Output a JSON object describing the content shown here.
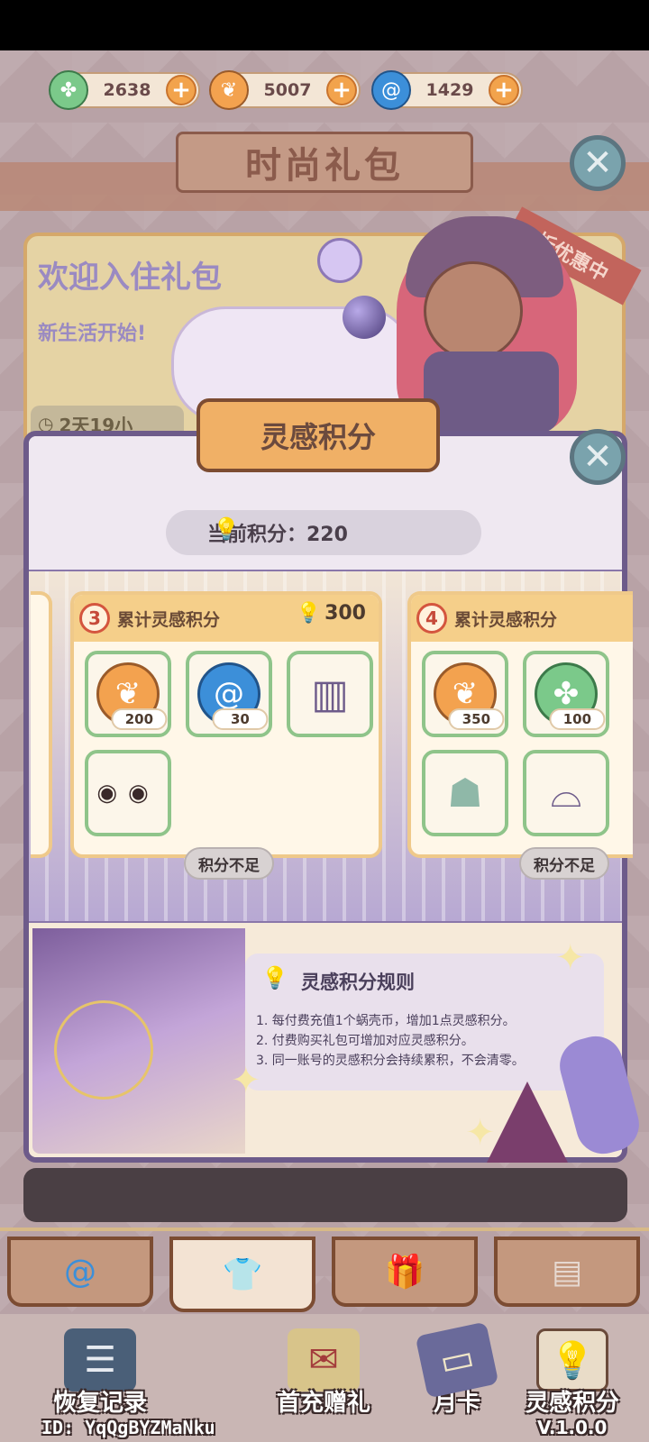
{
  "currencies": [
    {
      "name": "clover-coin",
      "value": "2638",
      "color": "#7bc98a"
    },
    {
      "name": "shell-coin",
      "value": "5007",
      "color": "#f3a24f"
    },
    {
      "name": "swirl-gem",
      "value": "1429",
      "color": "#3c8fd9"
    }
  ],
  "shop_title": "时尚礼包",
  "welcome": {
    "title": "欢迎入住礼包",
    "subtitle": "新生活开始!",
    "timer": "2天19小",
    "discount_badge": "折优惠中"
  },
  "modal": {
    "title": "灵感积分",
    "current_points_label": "当前积分：220",
    "tiers": [
      {
        "number": "3",
        "label": "累计灵感积分",
        "required": "300",
        "items": [
          {
            "icon": "shell-coin-icon",
            "qty": "200"
          },
          {
            "icon": "swirl-gem-icon",
            "qty": "30"
          },
          {
            "icon": "pants-icon",
            "qty": ""
          },
          {
            "icon": "eyes-icon",
            "qty": ""
          }
        ],
        "status": "积分不足"
      },
      {
        "number": "4",
        "label": "累计灵感积分",
        "items": [
          {
            "icon": "shell-coin-icon",
            "qty": "350"
          },
          {
            "icon": "clover-coin-icon",
            "qty": "100"
          },
          {
            "icon": "veil-dress-icon",
            "qty": ""
          },
          {
            "icon": "top-outfit-icon",
            "qty": ""
          }
        ],
        "status": "积分不足"
      }
    ],
    "rules": {
      "title": "灵感积分规则",
      "items": [
        "1. 每付费充值1个蜗壳币，增加1点灵感积分。",
        "2. 付费购买礼包可增加对应灵感积分。",
        "3. 同一账号的灵感积分会持续累积，不会清零。"
      ]
    }
  },
  "tabs": [
    {
      "icon": "swirl-icon",
      "active": false
    },
    {
      "icon": "shirt-icon",
      "active": true
    },
    {
      "icon": "gift-icon",
      "active": false
    },
    {
      "icon": "scroll-icon",
      "active": false
    }
  ],
  "bottom_nav": [
    {
      "label": "恢复记录",
      "icon": "clipboard-icon"
    },
    {
      "label": "首充赠礼",
      "icon": "envelope-icon"
    },
    {
      "label": "月卡",
      "icon": "card-icon"
    },
    {
      "label": "灵感积分",
      "icon": "bulb-frame-icon"
    }
  ],
  "footer": {
    "id": "ID: YqQgBYZMaNku",
    "version": "V.1.0.0"
  },
  "colors": {
    "modal_border": "#6d5b8a",
    "tier_header": "#f5cf8a",
    "item_border": "#8fc48a",
    "title_plate": "#f0b066"
  }
}
